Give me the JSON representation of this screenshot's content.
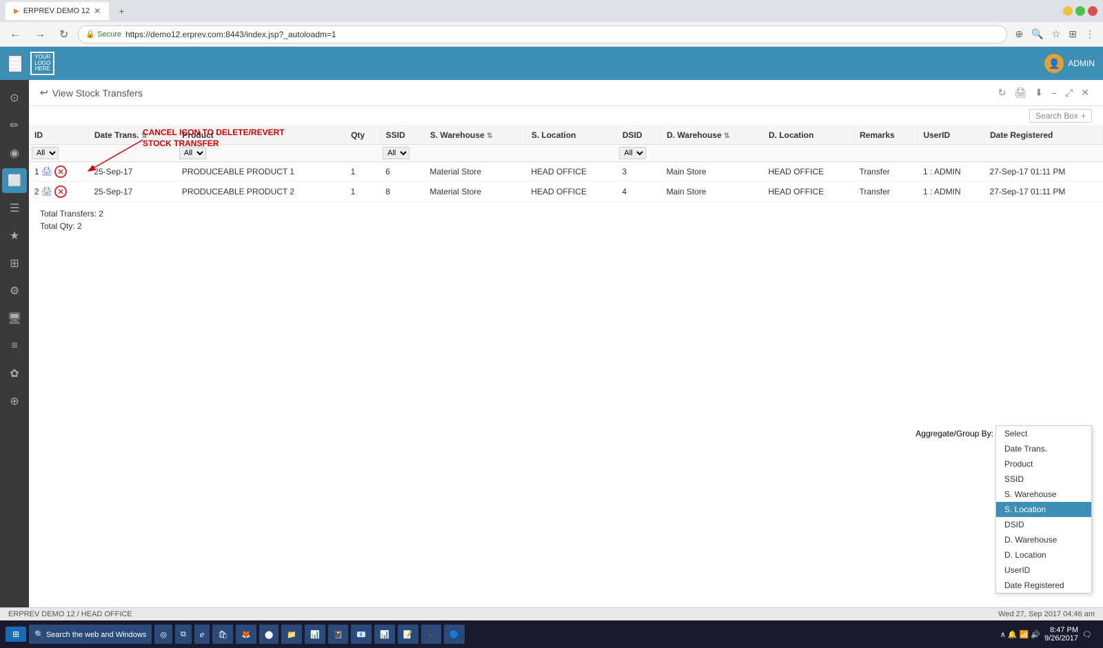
{
  "browser": {
    "tab_title": "ERPREV DEMO 12",
    "url": "https://demo12.erprev.com:8443/index.jsp?_autoloadm=1",
    "secure_label": "Secure"
  },
  "header": {
    "logo_lines": [
      "YOUR",
      "LOGO",
      "HERE"
    ],
    "admin_label": "ADMIN"
  },
  "page": {
    "title": "View Stock Transfers",
    "search_placeholder": "Search Box"
  },
  "annotation": {
    "text_line1": "CANCEL ICON TO DELETE/REVERT",
    "text_line2": "STOCK TRANSFER"
  },
  "table": {
    "columns": [
      "ID",
      "Date Trans.",
      "Product",
      "Qty",
      "SSID",
      "S. Warehouse",
      "S. Location",
      "DSID",
      "D. Warehouse",
      "D. Location",
      "Remarks",
      "UserID",
      "Date Registered"
    ],
    "filter_options": {
      "id": [
        "All"
      ],
      "product": [
        "All"
      ],
      "ssid": [
        "All"
      ],
      "dsid": [
        "All"
      ]
    },
    "rows": [
      {
        "id": "1",
        "date_trans": "25-Sep-17",
        "product": "PRODUCEABLE PRODUCT 1",
        "qty": "1",
        "ssid": "6",
        "s_warehouse": "Material Store",
        "s_location": "HEAD OFFICE",
        "dsid": "3",
        "d_warehouse": "Main Store",
        "d_location": "HEAD OFFICE",
        "remarks": "Transfer",
        "user_id": "1 : ADMIN",
        "date_registered": "27-Sep-17 01:11 PM"
      },
      {
        "id": "2",
        "date_trans": "25-Sep-17",
        "product": "PRODUCEABLE PRODUCT 2",
        "qty": "1",
        "ssid": "8",
        "s_warehouse": "Material Store",
        "s_location": "HEAD OFFICE",
        "dsid": "4",
        "d_warehouse": "Main Store",
        "d_location": "HEAD OFFICE",
        "remarks": "Transfer",
        "user_id": "1 : ADMIN",
        "date_registered": "27-Sep-17 01:11 PM"
      }
    ]
  },
  "totals": {
    "transfers_label": "Total Transfers: 2",
    "qty_label": "Total Qty: 2"
  },
  "aggregate": {
    "label": "Aggregate/Group By:",
    "selected": "Select",
    "options": [
      "Select",
      "Date Trans.",
      "Product",
      "SSID",
      "S. Warehouse",
      "S. Location",
      "DSID",
      "D. Warehouse",
      "D. Location",
      "UserID",
      "Date Registered"
    ]
  },
  "status_bar": {
    "company": "ERPREV DEMO 12 / HEAD OFFICE",
    "datetime": "Wed 27, Sep 2017 04:46 am"
  },
  "taskbar": {
    "start_label": "⊞",
    "search_placeholder": "Search the web and Windows",
    "time": "8:47 PM",
    "date": "9/26/2017"
  },
  "sidebar": {
    "items": [
      {
        "icon": "⊙",
        "name": "dashboard"
      },
      {
        "icon": "✏",
        "name": "edit"
      },
      {
        "icon": "◉",
        "name": "circle"
      },
      {
        "icon": "⬜",
        "name": "box"
      },
      {
        "icon": "☰",
        "name": "list"
      },
      {
        "icon": "★",
        "name": "star"
      },
      {
        "icon": "⊞",
        "name": "grid"
      },
      {
        "icon": "⚙",
        "name": "settings"
      },
      {
        "icon": "🖥",
        "name": "monitor"
      },
      {
        "icon": "≡",
        "name": "menu2"
      },
      {
        "icon": "✿",
        "name": "flower"
      },
      {
        "icon": "⊕",
        "name": "plus"
      }
    ]
  }
}
